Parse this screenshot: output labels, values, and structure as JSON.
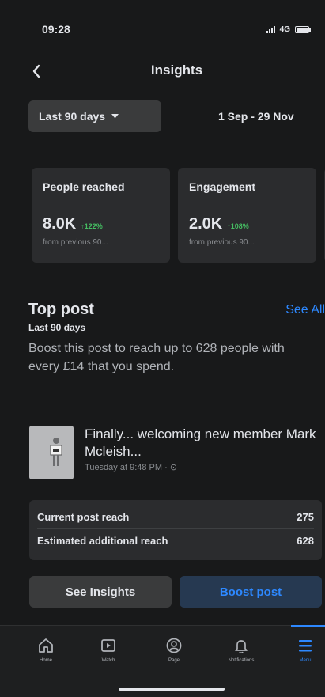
{
  "status_bar": {
    "time": "09:28",
    "network": "4G"
  },
  "header": {
    "title": "Insights",
    "back_icon": "chevron-left-icon"
  },
  "range": {
    "selected": "Last 90 days",
    "dates": "1 Sep - 29 Nov"
  },
  "cards": [
    {
      "title": "People reached",
      "value": "8.0K",
      "delta": "↑122%",
      "sub": "from previous 90..."
    },
    {
      "title": "Engagement",
      "value": "2.0K",
      "delta": "↑108%",
      "sub": "from previous 90..."
    }
  ],
  "top_post": {
    "title": "Top post",
    "see_all": "See All",
    "period": "Last 90 days",
    "boost_text": "Boost this post to reach up to 628 people with every £14 that you spend.",
    "post": {
      "title": "Finally... welcoming new member Mark Mcleish...",
      "time": "Tuesday at 9:48 PM · ⊙"
    },
    "reach": [
      {
        "label": "Current post reach",
        "value": "275"
      },
      {
        "label": "Estimated additional reach",
        "value": "628"
      }
    ],
    "buttons": {
      "insights": "See Insights",
      "boost": "Boost post"
    }
  },
  "tabs": [
    {
      "label": "Home",
      "icon": "home-icon"
    },
    {
      "label": "Watch",
      "icon": "watch-icon"
    },
    {
      "label": "Page",
      "icon": "page-icon"
    },
    {
      "label": "Notifications",
      "icon": "bell-icon"
    },
    {
      "label": "Menu",
      "icon": "menu-icon",
      "active": true
    }
  ],
  "colors": {
    "accent": "#2d88ff",
    "positive": "#45bd62",
    "background": "#18191a",
    "surface": "#2b2c2e"
  }
}
